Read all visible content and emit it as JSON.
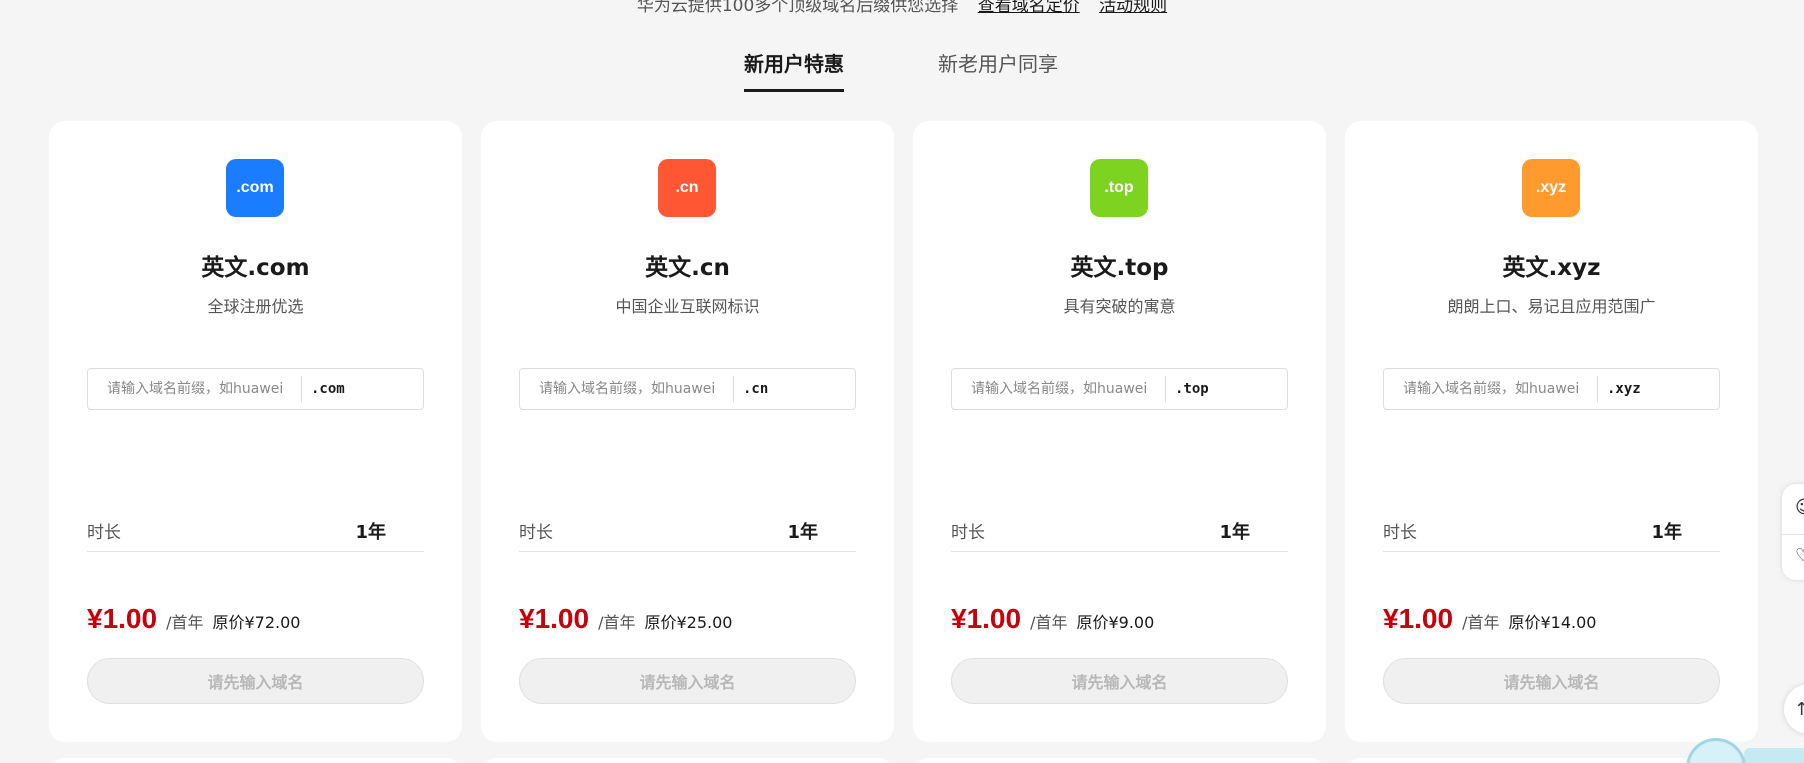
{
  "top_line": {
    "text": "华为云提供100多个顶级域名后缀供您选择",
    "link_1": "查看域名定价",
    "link_2": "活动规则"
  },
  "tabs": [
    {
      "label": "新用户特惠",
      "active": true
    },
    {
      "label": "新老用户同享",
      "active": false
    }
  ],
  "common": {
    "input_placeholder": "请输入域名前缀，如huawei",
    "duration_label": "时长",
    "duration_value": "1年",
    "unit": "/首年",
    "button_label": "请先输入域名"
  },
  "cards": [
    {
      "badge": ".com",
      "badge_color": "#1a7dff",
      "title": "英文.com",
      "desc": "全球注册优选",
      "suffix": ".com",
      "price": "¥1.00",
      "orig": "原价¥72.00"
    },
    {
      "badge": ".cn",
      "badge_color": "#ff5733",
      "title": "英文.cn",
      "desc": "中国企业互联网标识",
      "suffix": ".cn",
      "price": "¥1.00",
      "orig": "原价¥25.00"
    },
    {
      "badge": ".top",
      "badge_color": "#7ed321",
      "title": "英文.top",
      "desc": "具有突破的寓意",
      "suffix": ".top",
      "price": "¥1.00",
      "orig": "原价¥9.00"
    },
    {
      "badge": ".xyz",
      "badge_color": "#ff9a2e",
      "title": "英文.xyz",
      "desc": "朗朗上口、易记且应用范围广",
      "suffix": ".xyz",
      "price": "¥1.00",
      "orig": "原价¥14.00"
    }
  ],
  "colors": {
    "price": "#c7000b",
    "background": "#f5f5f5"
  },
  "side_tools": {
    "icon_1": "headset-icon",
    "icon_2": "heart-icon",
    "scroll_top_icon": "arrow-up-icon"
  }
}
